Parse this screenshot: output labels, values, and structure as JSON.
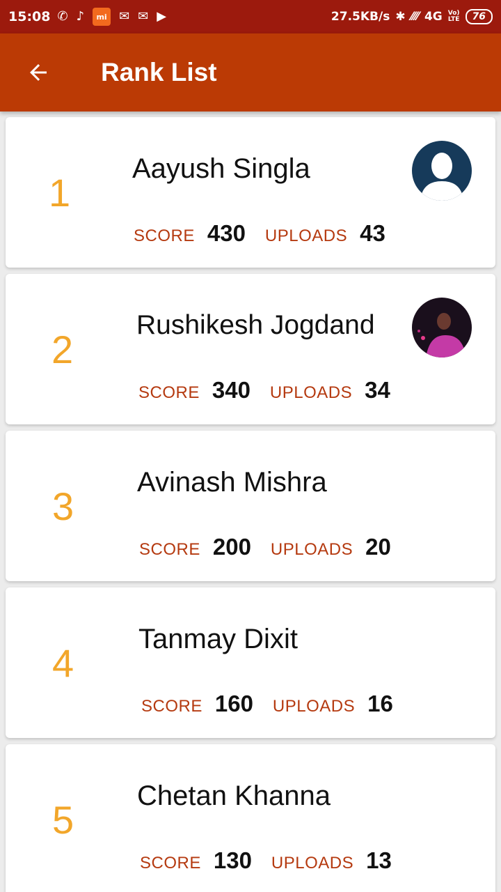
{
  "status_bar": {
    "time": "15:08",
    "speed": "27.5KB/s",
    "network": "4G",
    "volte_top": "Vo)",
    "volte_bottom": "LTE",
    "battery": "76"
  },
  "app_bar": {
    "title": "Rank List"
  },
  "labels": {
    "score": "SCORE",
    "uploads": "UPLOADS"
  },
  "ranks": [
    {
      "rank": "1",
      "name": "Aayush Singla",
      "score": "430",
      "uploads": "43",
      "avatar": "default-user"
    },
    {
      "rank": "2",
      "name": "Rushikesh Jogdand",
      "score": "340",
      "uploads": "34",
      "avatar": "photo"
    },
    {
      "rank": "3",
      "name": "Avinash Mishra",
      "score": "200",
      "uploads": "20",
      "avatar": ""
    },
    {
      "rank": "4",
      "name": "Tanmay Dixit",
      "score": "160",
      "uploads": "16",
      "avatar": ""
    },
    {
      "rank": "5",
      "name": "Chetan Khanna",
      "score": "130",
      "uploads": "13",
      "avatar": ""
    }
  ],
  "colors": {
    "status_bar": "#9c1a0d",
    "app_bar": "#bb3a05",
    "rank_number": "#f2a62a",
    "stat_label": "#b53a10"
  }
}
